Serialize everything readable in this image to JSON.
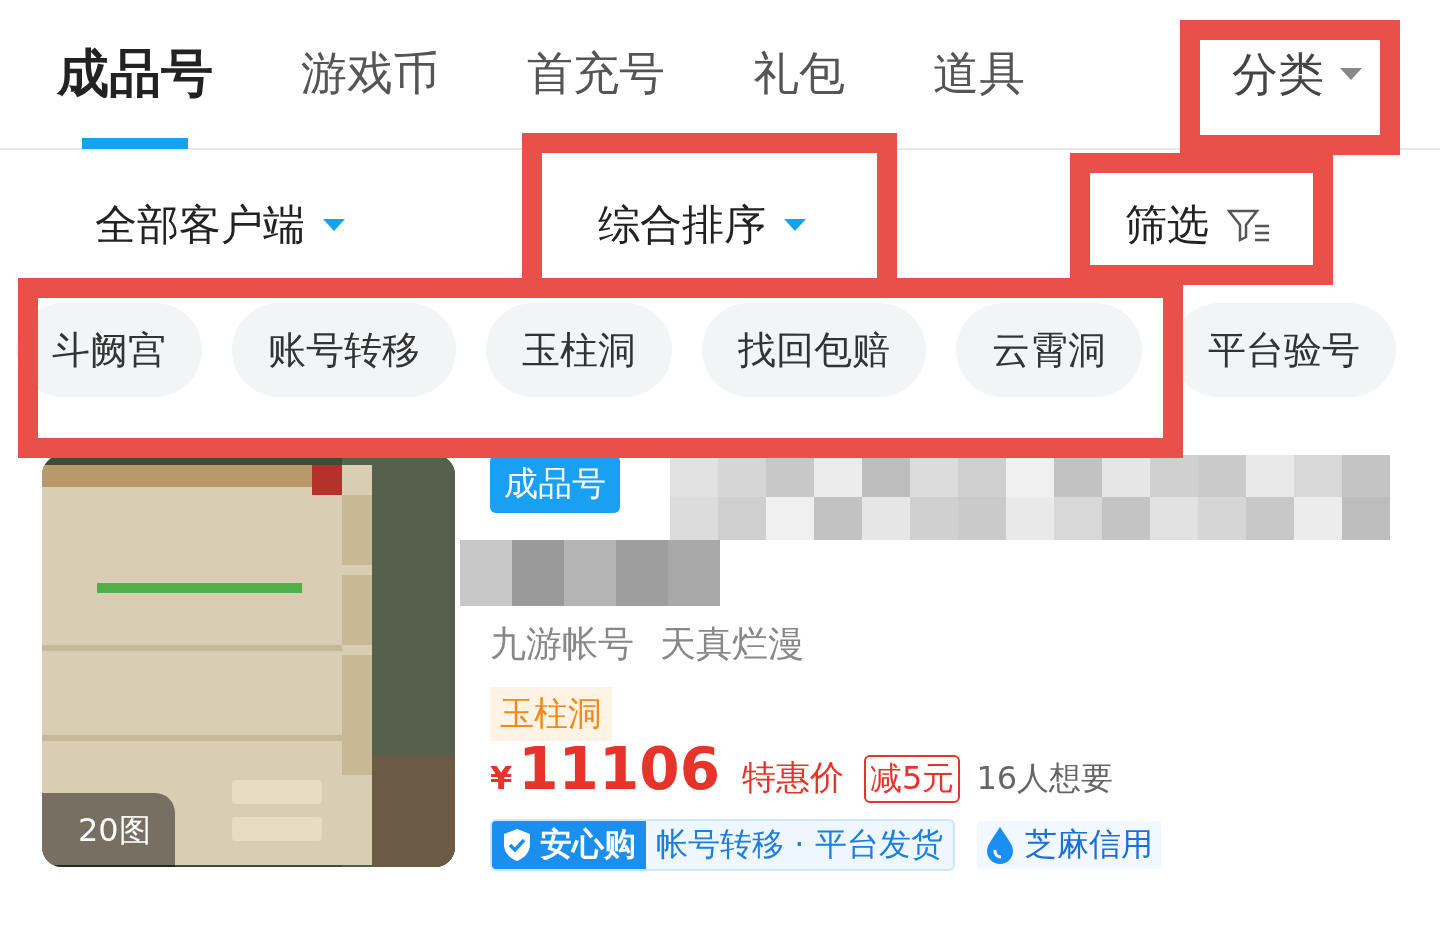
{
  "tabs": [
    {
      "label": "成品号",
      "selected": true
    },
    {
      "label": "游戏币",
      "selected": false
    },
    {
      "label": "首充号",
      "selected": false
    },
    {
      "label": "礼包",
      "selected": false
    },
    {
      "label": "道具",
      "selected": false
    }
  ],
  "category_button": {
    "label": "分类"
  },
  "filters": [
    {
      "label": "全部客户端",
      "kind": "dropdown"
    },
    {
      "label": "综合排序",
      "kind": "dropdown"
    },
    {
      "label": "筛选",
      "kind": "filter"
    }
  ],
  "chips": [
    "斗阙宫",
    "账号转移",
    "玉柱洞",
    "找回包赔",
    "云霄洞",
    "平台验号"
  ],
  "listing": {
    "photo_count": "20图",
    "type_badge": "成品号",
    "seller": "九游帐号",
    "title": "天真烂漫",
    "server_tag": "玉柱洞",
    "currency": "¥",
    "price": "11106",
    "price_label": "特惠价",
    "coupon": "减5元",
    "wants": "16人想要",
    "guarantee_badge": "安心购",
    "guarantee_text": "帐号转移 · 平台发货",
    "credit": "芝麻信用"
  }
}
